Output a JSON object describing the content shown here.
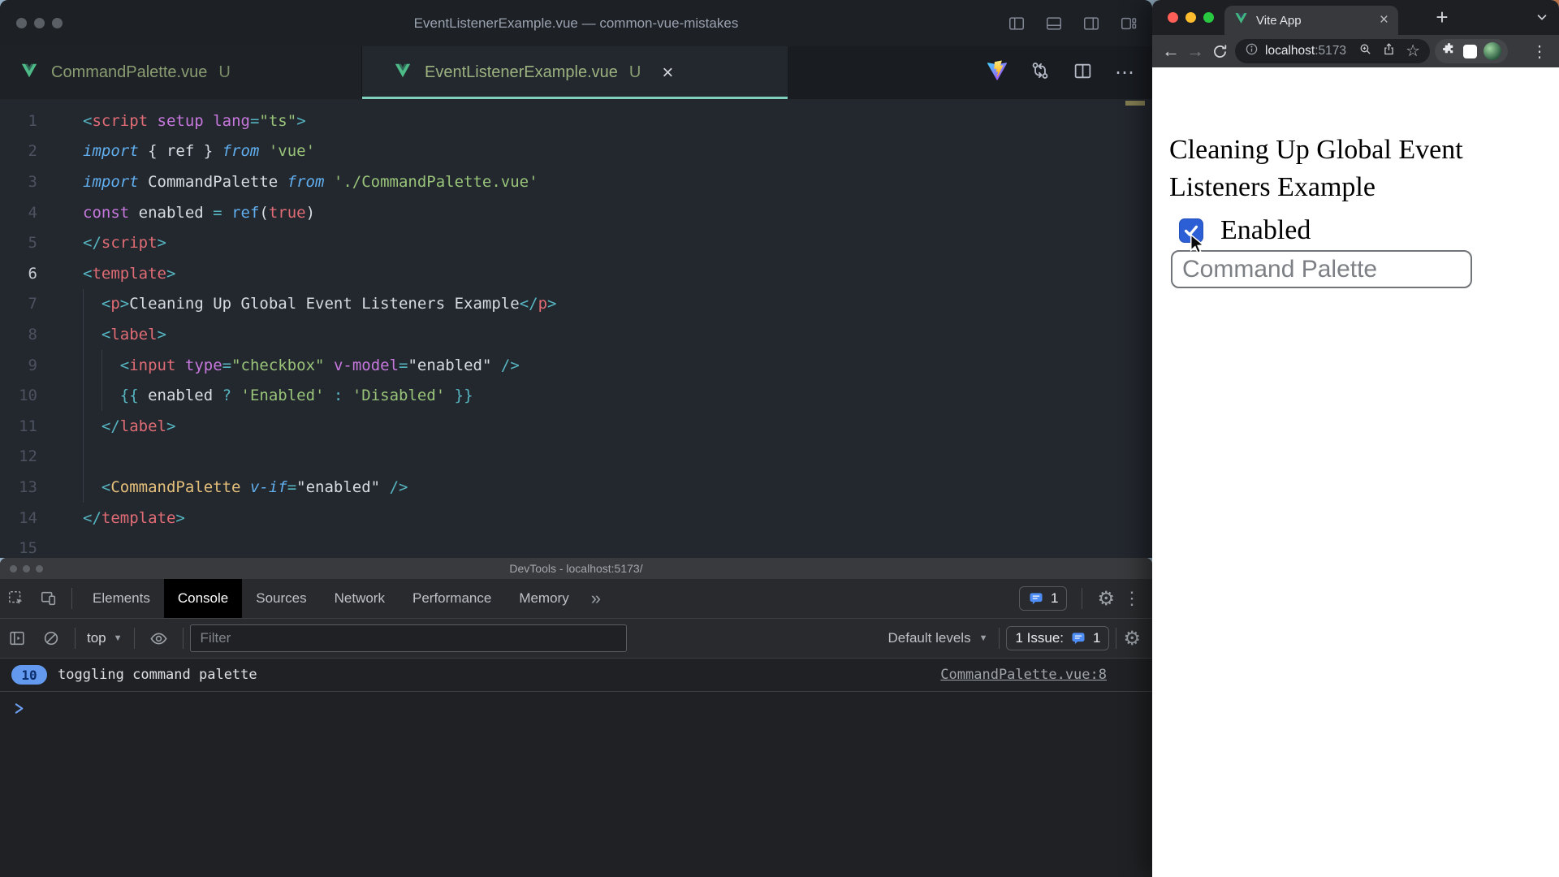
{
  "vscode": {
    "window_title": "EventListenerExample.vue — common-vue-mistakes",
    "tabs": [
      {
        "name": "CommandPalette.vue",
        "git_badge": "U",
        "active": false
      },
      {
        "name": "EventListenerExample.vue",
        "git_badge": "U",
        "active": true
      }
    ],
    "active_line": 6,
    "code_lines": [
      {
        "num": 1,
        "tokens": [
          [
            "p",
            "<"
          ],
          [
            "t",
            "script"
          ],
          [
            "w",
            " "
          ],
          [
            "a",
            "setup"
          ],
          [
            "w",
            " "
          ],
          [
            "a",
            "lang"
          ],
          [
            "p",
            "="
          ],
          [
            "s",
            "\"ts\""
          ],
          [
            "p",
            ">"
          ]
        ]
      },
      {
        "num": 2,
        "tokens": [
          [
            "k",
            "import"
          ],
          [
            "w",
            " { ref } "
          ],
          [
            "k",
            "from"
          ],
          [
            "w",
            " "
          ],
          [
            "s",
            "'vue'"
          ]
        ]
      },
      {
        "num": 3,
        "tokens": [
          [
            "k",
            "import"
          ],
          [
            "w",
            " CommandPalette "
          ],
          [
            "k",
            "from"
          ],
          [
            "w",
            " "
          ],
          [
            "s",
            "'./CommandPalette.vue'"
          ]
        ]
      },
      {
        "num": 4,
        "tokens": [
          [
            "a",
            "const"
          ],
          [
            "w",
            " enabled "
          ],
          [
            "p",
            "="
          ],
          [
            "w",
            " "
          ],
          [
            "f",
            "ref"
          ],
          [
            "w",
            "("
          ],
          [
            "b",
            "true"
          ],
          [
            "w",
            ")"
          ]
        ]
      },
      {
        "num": 5,
        "tokens": [
          [
            "p",
            "</"
          ],
          [
            "t",
            "script"
          ],
          [
            "p",
            ">"
          ]
        ]
      },
      {
        "num": 6,
        "tokens": [
          [
            "p",
            "<"
          ],
          [
            "t",
            "template"
          ],
          [
            "p",
            ">"
          ]
        ]
      },
      {
        "num": 7,
        "tokens": [
          [
            "w",
            "  "
          ],
          [
            "p",
            "<"
          ],
          [
            "t",
            "p"
          ],
          [
            "p",
            ">"
          ],
          [
            "w",
            "Cleaning Up Global Event Listeners Example"
          ],
          [
            "p",
            "</"
          ],
          [
            "t",
            "p"
          ],
          [
            "p",
            ">"
          ]
        ]
      },
      {
        "num": 8,
        "tokens": [
          [
            "w",
            "  "
          ],
          [
            "p",
            "<"
          ],
          [
            "t",
            "label"
          ],
          [
            "p",
            ">"
          ]
        ]
      },
      {
        "num": 9,
        "tokens": [
          [
            "w",
            "    "
          ],
          [
            "p",
            "<"
          ],
          [
            "t",
            "input"
          ],
          [
            "w",
            " "
          ],
          [
            "a",
            "type"
          ],
          [
            "p",
            "="
          ],
          [
            "s",
            "\"checkbox\""
          ],
          [
            "w",
            " "
          ],
          [
            "a",
            "v-model"
          ],
          [
            "p",
            "="
          ],
          [
            "w",
            "\"enabled\""
          ],
          [
            "w",
            " "
          ],
          [
            "p",
            "/>"
          ]
        ]
      },
      {
        "num": 10,
        "tokens": [
          [
            "w",
            "    "
          ],
          [
            "p",
            "{{"
          ],
          [
            "w",
            " enabled "
          ],
          [
            "p",
            "?"
          ],
          [
            "w",
            " "
          ],
          [
            "s",
            "'Enabled'"
          ],
          [
            "w",
            " "
          ],
          [
            "p",
            ":"
          ],
          [
            "w",
            " "
          ],
          [
            "s",
            "'Disabled'"
          ],
          [
            "w",
            " "
          ],
          [
            "p",
            "}}"
          ]
        ]
      },
      {
        "num": 11,
        "tokens": [
          [
            "w",
            "  "
          ],
          [
            "p",
            "</"
          ],
          [
            "t",
            "label"
          ],
          [
            "p",
            ">"
          ]
        ]
      },
      {
        "num": 12,
        "tokens": []
      },
      {
        "num": 13,
        "tokens": [
          [
            "w",
            "  "
          ],
          [
            "p",
            "<"
          ],
          [
            "c",
            "CommandPalette"
          ],
          [
            "w",
            " "
          ],
          [
            "k",
            "v-if"
          ],
          [
            "p",
            "="
          ],
          [
            "w",
            "\"enabled\""
          ],
          [
            "w",
            " "
          ],
          [
            "p",
            "/>"
          ]
        ]
      },
      {
        "num": 14,
        "tokens": [
          [
            "p",
            "</"
          ],
          [
            "t",
            "template"
          ],
          [
            "p",
            ">"
          ]
        ]
      },
      {
        "num": 15,
        "tokens": []
      }
    ]
  },
  "devtools": {
    "window_title": "DevTools - localhost:5173/",
    "tabs": [
      "Elements",
      "Console",
      "Sources",
      "Network",
      "Performance",
      "Memory"
    ],
    "active_tab": "Console",
    "messages_badge": "1",
    "toolbar": {
      "context": "top",
      "filter_placeholder": "Filter",
      "levels": "Default levels",
      "issue_text": "1 Issue:",
      "issue_count": "1"
    },
    "console": {
      "repeat_count": "10",
      "message": "toggling command palette",
      "source_link": "CommandPalette.vue:8"
    }
  },
  "chrome": {
    "tab_title": "Vite App",
    "url": {
      "host": "localhost",
      "port": ":5173"
    },
    "page": {
      "heading": "Cleaning Up Global Event Listeners Example",
      "checkbox_label": "Enabled",
      "command_input_placeholder": "Command Palette"
    }
  },
  "glyphs": {
    "close": "×",
    "new_tab": "+",
    "more_v": "⋮",
    "more_h": "⋯",
    "overflow": "»",
    "star": "☆",
    "back": "←",
    "forward": "→",
    "dropdown": "▼",
    "gear": "⚙"
  },
  "colors": {
    "vue_green": "#41b883",
    "tab_underline": "#7ed0bd",
    "checkbox_blue": "#2c5ed6",
    "console_badge_blue": "#639af0",
    "devtools_issue_blue": "#4e8df6"
  }
}
